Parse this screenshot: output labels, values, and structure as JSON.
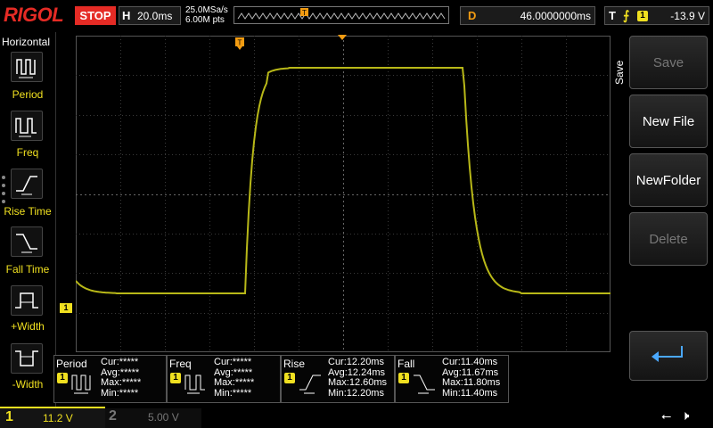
{
  "brand": "RIGOL",
  "run_state": "STOP",
  "horizontal_scale": {
    "label": "H",
    "value": "20.0ms"
  },
  "sample_rate": "25.0MSa/s",
  "memory_depth": "6.00M pts",
  "delay": {
    "label": "D",
    "value": "46.0000000ms"
  },
  "trigger": {
    "label": "T",
    "channel": "1",
    "level": "-13.9 V",
    "icon": "rising-edge-trigger-icon"
  },
  "left_panel": {
    "title": "Horizontal",
    "items": [
      {
        "label": "Period"
      },
      {
        "label": "Freq"
      },
      {
        "label": "Rise Time"
      },
      {
        "label": "Fall Time"
      },
      {
        "label": "+Width"
      },
      {
        "label": "-Width"
      }
    ]
  },
  "right_panel": {
    "tab": "Save",
    "buttons": [
      {
        "label": "Save",
        "enabled": false
      },
      {
        "label": "New File",
        "enabled": true
      },
      {
        "label": "NewFolder",
        "enabled": true
      },
      {
        "label": "Delete",
        "enabled": false
      }
    ],
    "return_icon": "return-arrow-icon"
  },
  "measurements": [
    {
      "name": "Period",
      "ch": "1",
      "cur": "Cur:*****",
      "avg": "Avg:*****",
      "max": "Max:*****",
      "min": "Min:*****"
    },
    {
      "name": "Freq",
      "ch": "1",
      "cur": "Cur:*****",
      "avg": "Avg:*****",
      "max": "Max:*****",
      "min": "Min:*****"
    },
    {
      "name": "Rise",
      "ch": "1",
      "cur": "Cur:12.20ms",
      "avg": "Avg:12.24ms",
      "max": "Max:12.60ms",
      "min": "Min:12.20ms"
    },
    {
      "name": "Fall",
      "ch": "1",
      "cur": "Cur:11.40ms",
      "avg": "Avg:11.67ms",
      "max": "Max:11.80ms",
      "min": "Min:11.40ms"
    }
  ],
  "channels": [
    {
      "num": "1",
      "scale": "11.2 V",
      "active": true
    },
    {
      "num": "2",
      "scale": "5.00 V",
      "active": false
    }
  ],
  "ground_marker": "1",
  "colors": {
    "ch1": "#f0e020",
    "trace": "#b8b818",
    "brand": "#e52b25",
    "trigger": "#f39c12",
    "grid": "#3a3a3a"
  }
}
